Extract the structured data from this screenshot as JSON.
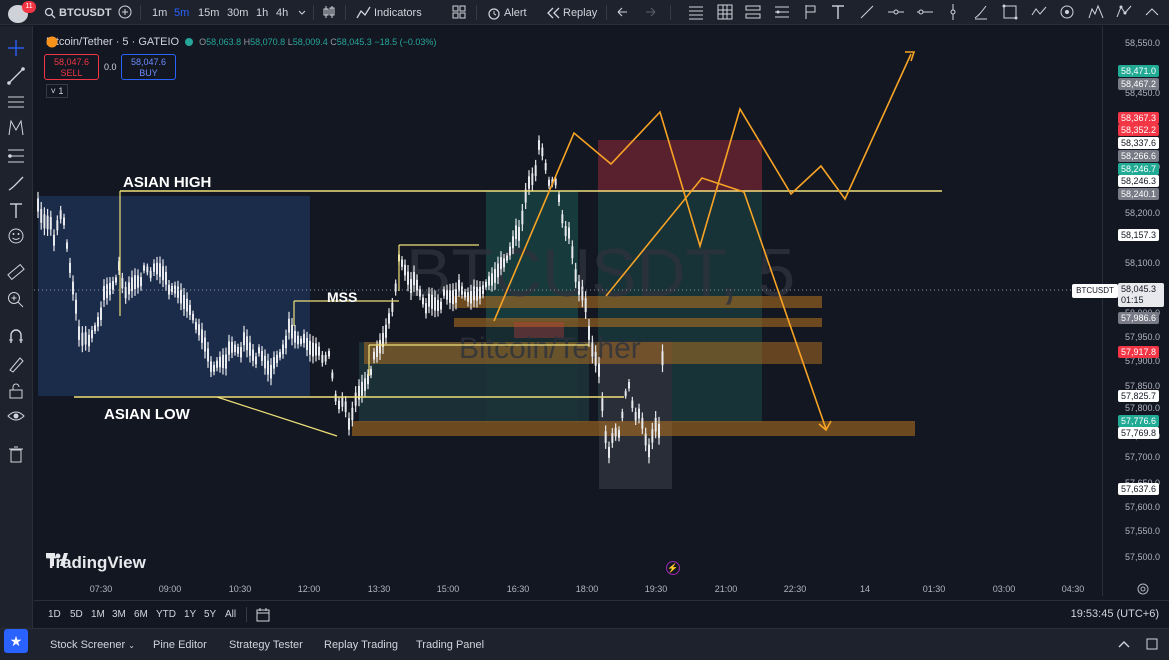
{
  "top_toolbar": {
    "notification_count": "11",
    "symbol": "BTCUSDT",
    "intervals": [
      "1m",
      "5m",
      "15m",
      "30m",
      "1h",
      "4h"
    ],
    "active_interval": "5m",
    "indicators_label": "Indicators",
    "alert_label": "Alert",
    "replay_label": "Replay"
  },
  "legend": {
    "symbol_title": "Bitcoin/Tether · 5 · GATEIO",
    "open_label": "O",
    "open": "58,063.8",
    "high_label": "H",
    "high": "58,070.8",
    "low_label": "L",
    "low": "58,009.4",
    "close_label": "C",
    "close": "58,045.3",
    "change": "−18.5 (−0.03%)"
  },
  "trade": {
    "sell_price": "58,047.6",
    "sell_label": "SELL",
    "spread": "0.0",
    "buy_price": "58,047.6",
    "buy_label": "BUY",
    "collapse_count": "1"
  },
  "watermark": {
    "ticker": "BTCUSDT, 5",
    "name": "Bitcoin/Tether"
  },
  "annotations": {
    "asian_high": "ASIAN HIGH",
    "asian_low": "ASIAN LOW",
    "mss": "MSS"
  },
  "brand": "TradingView",
  "price_axis": {
    "ticks": [
      "58,550.0",
      "58,450.0",
      "58,300.0",
      "58,200.0",
      "58,100.0",
      "58,000.0",
      "57,950.0",
      "57,900.0",
      "57,850.0",
      "57,800.0",
      "57,750.0",
      "57,700.0",
      "57,650.0",
      "57,600.0",
      "57,550.0",
      "57,500.0"
    ],
    "labels": [
      {
        "text": "58,471.0",
        "color": "#22ab94"
      },
      {
        "text": "58,467.2",
        "color": "#787b86"
      },
      {
        "text": "58,367.3",
        "color": "#f23645"
      },
      {
        "text": "58,352.2",
        "color": "#f23645"
      },
      {
        "text": "58,337.6",
        "color": "#ffffff"
      },
      {
        "text": "58,266.6",
        "color": "#787b86"
      },
      {
        "text": "58,246.7",
        "color": "#22ab94"
      },
      {
        "text": "58,246.3",
        "color": "#ffffff"
      },
      {
        "text": "58,240.1",
        "color": "#787b86"
      },
      {
        "text": "58,157.3",
        "color": "#ffffff"
      },
      {
        "text": "57,986.6",
        "color": "#787b86"
      },
      {
        "text": "57,917.8",
        "color": "#f23645"
      },
      {
        "text": "57,825.7",
        "color": "#ffffff"
      },
      {
        "text": "57,776.6",
        "color": "#22ab94"
      },
      {
        "text": "57,769.8",
        "color": "#ffffff"
      },
      {
        "text": "57,637.6",
        "color": "#ffffff"
      }
    ],
    "current_symbol": "BTCUSDT",
    "current_price": "58,045.3",
    "countdown": "01:15"
  },
  "time_axis": [
    "07:30",
    "09:00",
    "10:30",
    "12:00",
    "13:30",
    "15:00",
    "16:30",
    "18:00",
    "19:30",
    "21:00",
    "22:30",
    "14",
    "01:30",
    "03:00",
    "04:30"
  ],
  "ranges": [
    "1D",
    "5D",
    "1M",
    "3M",
    "6M",
    "YTD",
    "1Y",
    "5Y",
    "All"
  ],
  "clock": "19:53:45 (UTC+6)",
  "panels": [
    "Stock Screener",
    "Pine Editor",
    "Strategy Tester",
    "Replay Trading",
    "Trading Panel"
  ]
}
